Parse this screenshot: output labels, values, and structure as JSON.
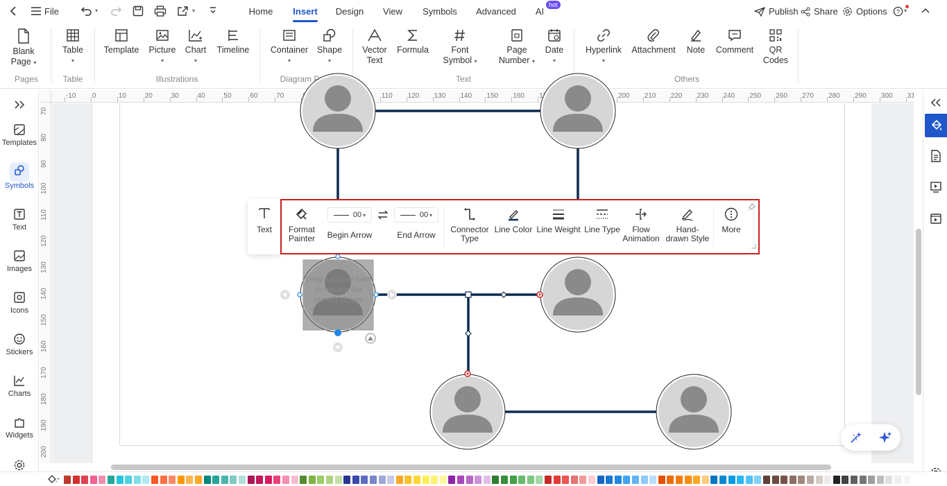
{
  "topbar": {
    "file_label": "File",
    "tabs": [
      "Home",
      "Insert",
      "Design",
      "View",
      "Symbols",
      "Advanced",
      "AI"
    ],
    "active_tab": "Insert",
    "hot_badge": "hot",
    "publish": "Publish",
    "share": "Share",
    "options": "Options"
  },
  "ribbon": {
    "items": {
      "blank_page": [
        "Blank",
        "Page"
      ],
      "table": "Table",
      "template": "Template",
      "picture": "Picture",
      "chart": "Chart",
      "timeline": "Timeline",
      "container": "Container",
      "shape": "Shape",
      "vector_text": [
        "Vector",
        "Text"
      ],
      "formula": "Formula",
      "font_symbol": [
        "Font",
        "Symbol"
      ],
      "page_number": [
        "Page",
        "Number"
      ],
      "date": "Date",
      "hyperlink": "Hyperlink",
      "attachment": "Attachment",
      "note": "Note",
      "comment": "Comment",
      "qr_codes": [
        "QR",
        "Codes"
      ]
    },
    "groups": [
      "Pages",
      "Table",
      "Illustrations",
      "Diagram Parts",
      "Text",
      "Others"
    ]
  },
  "leftbar": {
    "items": [
      "Templates",
      "Symbols",
      "Text",
      "Images",
      "Icons",
      "Stickers",
      "Charts",
      "Widgets"
    ],
    "active": "Symbols"
  },
  "ruler": {
    "h_ticks": [
      "-10",
      "0",
      "10",
      "20",
      "30",
      "40",
      "50",
      "60",
      "70",
      "80",
      "90",
      "100",
      "110",
      "120",
      "130",
      "140",
      "150",
      "160",
      "170",
      "180",
      "190",
      "200",
      "210",
      "220",
      "230",
      "240",
      "250",
      "260",
      "270",
      "280",
      "290",
      "300",
      "31"
    ],
    "v_ticks": [
      "70",
      "80",
      "90",
      "100",
      "110",
      "120",
      "130",
      "140",
      "150",
      "160",
      "170",
      "180",
      "190",
      "200"
    ]
  },
  "floating_toolbar": {
    "text": "Text",
    "format_painter": [
      "Format",
      "Painter"
    ],
    "begin_arrow": "Begin Arrow",
    "begin_arrow_value": "00",
    "end_arrow": "End Arrow",
    "end_arrow_value": "00",
    "connector_type": [
      "Connector",
      "Type"
    ],
    "line_color": "Line Color",
    "line_weight": "Line Weight",
    "line_type": "Line Type",
    "flow_animation": [
      "Flow",
      "Animation"
    ],
    "hand_drawn": [
      "Hand-",
      "drawn Style"
    ],
    "more": "More"
  },
  "picture_placeholder": "Drag a picture here to replace the current picture",
  "colors": {
    "accent": "#1f56c9",
    "connector": "#0d2a4f",
    "highlight_border": "#cc1f1f",
    "palette": [
      "#c0392b",
      "#d0312d",
      "#e04050",
      "#f06292",
      "#f48fb1",
      "#26a69a",
      "#26c6da",
      "#4dd0e1",
      "#80deea",
      "#b2ebf2",
      "#ff5722",
      "#ff7043",
      "#ff8a65",
      "#ff9800",
      "#ffb74d",
      "#ffa726",
      "#00897b",
      "#26a69a",
      "#4db6ac",
      "#80cbc4",
      "#b2dfdb",
      "#ad1457",
      "#c2185b",
      "#d81b60",
      "#ec407a",
      "#f48fb1",
      "#f8bbd0",
      "#558b2f",
      "#7cb342",
      "#9ccc65",
      "#aed581",
      "#c5e1a5",
      "#283593",
      "#3949ab",
      "#5c6bc0",
      "#7986cb",
      "#9fa8da",
      "#c5cae9",
      "#f9a825",
      "#fbc02d",
      "#fdd835",
      "#ffee58",
      "#fff176",
      "#fff59d",
      "#8e24aa",
      "#ab47bc",
      "#ba68c8",
      "#ce93d8",
      "#e1bee7",
      "#2e7d32",
      "#388e3c",
      "#43a047",
      "#66bb6a",
      "#81c784",
      "#a5d6a7",
      "#c62828",
      "#e53935",
      "#ef5350",
      "#e57373",
      "#ef9a9a",
      "#ffcdd2",
      "#1565c0",
      "#1976d2",
      "#1e88e5",
      "#42a5f5",
      "#64b5f6",
      "#90caf9",
      "#bbdefb",
      "#e65100",
      "#ef6c00",
      "#f57c00",
      "#fb8c00",
      "#ffa726",
      "#ffcc80",
      "#0277bd",
      "#0288d1",
      "#039be5",
      "#29b6f6",
      "#4fc3f7",
      "#81d4fa",
      "#5d4037",
      "#6d4c41",
      "#795548",
      "#8d6e63",
      "#a1887f",
      "#bcaaa4",
      "#d7ccc8",
      "#efebe9",
      "#212121",
      "#424242",
      "#616161",
      "#757575",
      "#9e9e9e",
      "#bdbdbd",
      "#e0e0e0",
      "#eeeeee",
      "#f5f5f5"
    ]
  }
}
